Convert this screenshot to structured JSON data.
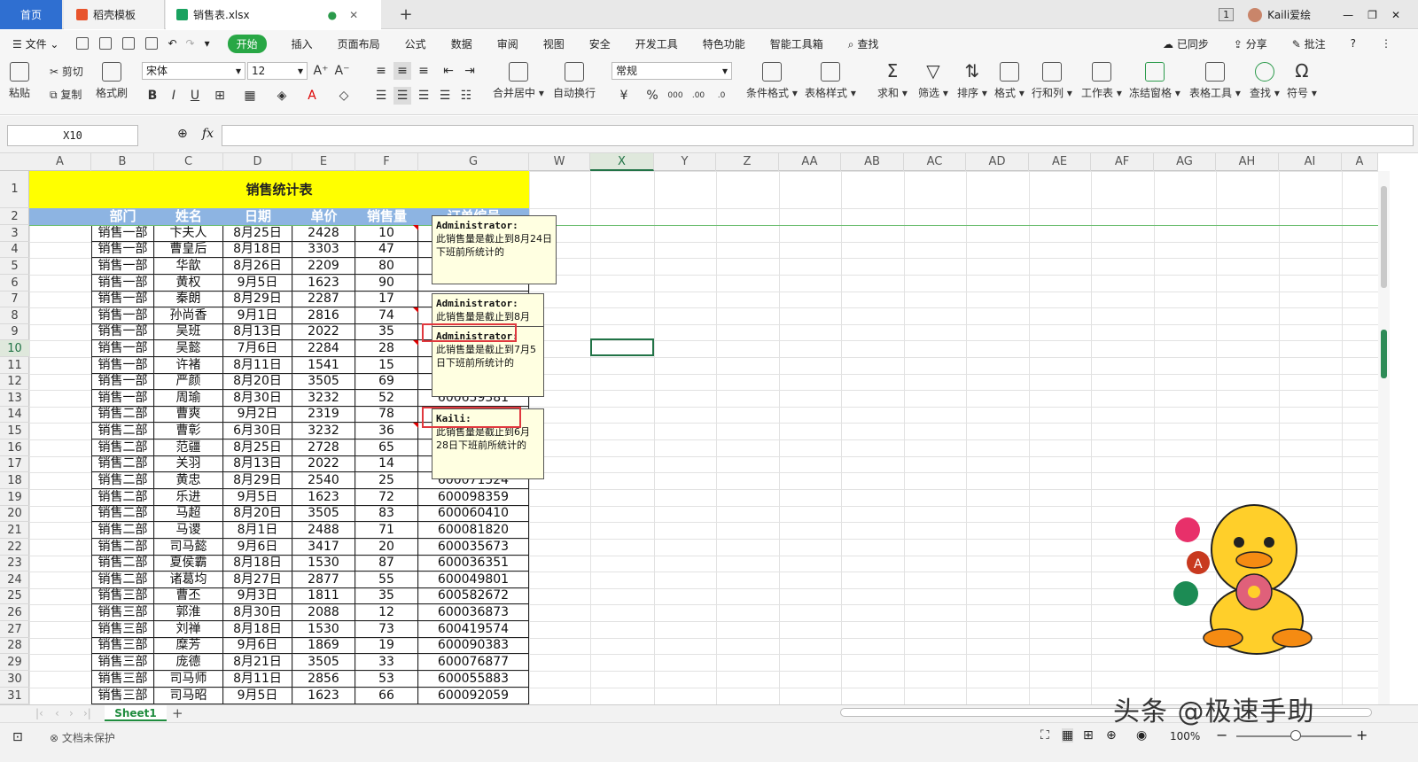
{
  "tabs": {
    "home": "首页",
    "templates": "稻壳模板",
    "file": "销售表.xlsx",
    "plus": "+"
  },
  "window": {
    "badge": "1",
    "user": "Kaili爱绘"
  },
  "menu": {
    "file": "文件",
    "items": [
      "开始",
      "插入",
      "页面布局",
      "公式",
      "数据",
      "审阅",
      "视图",
      "安全",
      "开发工具",
      "特色功能",
      "智能工具箱"
    ],
    "search": "查找",
    "sync": "已同步",
    "share": "分享",
    "comment": "批注",
    "help": "?"
  },
  "ribbon": {
    "paste": "粘贴",
    "cut": "剪切",
    "copy": "复制",
    "format_painter": "格式刷",
    "font": "宋体",
    "size": "12",
    "merge": "合并居中",
    "wrap": "自动换行",
    "numfmt": "常规",
    "cond_format": "条件格式",
    "table_style": "表格样式",
    "sum": "求和",
    "filter": "筛选",
    "sort": "排序",
    "format": "格式",
    "rowcol": "行和列",
    "sheet": "工作表",
    "freeze": "冻结窗格",
    "table_tools": "表格工具",
    "find": "查找",
    "symbol": "符号",
    "bold": "B",
    "italic": "I",
    "underline": "U",
    "percent": "%"
  },
  "formula": {
    "namebox": "X10",
    "fx": "fx"
  },
  "columns": [
    "A",
    "B",
    "C",
    "D",
    "E",
    "F",
    "G",
    "W",
    "X",
    "Y",
    "Z",
    "AA",
    "AB",
    "AC",
    "AD",
    "AE",
    "AF",
    "AG",
    "AH",
    "AI",
    "A"
  ],
  "rows": [
    "1",
    "2",
    "3",
    "4",
    "5",
    "6",
    "7",
    "8",
    "9",
    "10",
    "11",
    "12",
    "13",
    "14",
    "15",
    "16",
    "17",
    "18",
    "19",
    "20",
    "21",
    "22",
    "23",
    "24",
    "25",
    "26",
    "27",
    "28",
    "29",
    "30",
    "31"
  ],
  "sheet_title": "销售统计表",
  "headers": [
    "部门",
    "姓名",
    "日期",
    "单价",
    "销售量",
    "订单编号"
  ],
  "data": [
    [
      "销售一部",
      "卞夫人",
      "8月25日",
      "2428",
      "10",
      ""
    ],
    [
      "销售一部",
      "曹皇后",
      "8月18日",
      "3303",
      "47",
      ""
    ],
    [
      "销售一部",
      "华歆",
      "8月26日",
      "2209",
      "80",
      ""
    ],
    [
      "销售一部",
      "黄权",
      "9月5日",
      "1623",
      "90",
      ""
    ],
    [
      "销售一部",
      "秦朗",
      "8月29日",
      "2287",
      "17",
      ""
    ],
    [
      "销售一部",
      "孙尚香",
      "9月1日",
      "2816",
      "74",
      ""
    ],
    [
      "销售一部",
      "吴班",
      "8月13日",
      "2022",
      "35",
      ""
    ],
    [
      "销售一部",
      "吴懿",
      "7月6日",
      "2284",
      "28",
      ""
    ],
    [
      "销售一部",
      "许褚",
      "8月11日",
      "1541",
      "15",
      ""
    ],
    [
      "销售一部",
      "严颜",
      "8月20日",
      "3505",
      "69",
      ""
    ],
    [
      "销售一部",
      "周瑜",
      "8月30日",
      "3232",
      "52",
      "600659381"
    ],
    [
      "销售二部",
      "曹爽",
      "9月2日",
      "2319",
      "78",
      ""
    ],
    [
      "销售二部",
      "曹彰",
      "6月30日",
      "3232",
      "36",
      ""
    ],
    [
      "销售二部",
      "范疆",
      "8月25日",
      "2728",
      "65",
      ""
    ],
    [
      "销售二部",
      "关羽",
      "8月13日",
      "2022",
      "14",
      ""
    ],
    [
      "销售二部",
      "黄忠",
      "8月29日",
      "2540",
      "25",
      "600071524"
    ],
    [
      "销售二部",
      "乐进",
      "9月5日",
      "1623",
      "72",
      "600098359"
    ],
    [
      "销售二部",
      "马超",
      "8月20日",
      "3505",
      "83",
      "600060410"
    ],
    [
      "销售二部",
      "马谡",
      "8月1日",
      "2488",
      "71",
      "600081820"
    ],
    [
      "销售二部",
      "司马懿",
      "9月6日",
      "3417",
      "20",
      "600035673"
    ],
    [
      "销售二部",
      "夏侯霸",
      "8月18日",
      "1530",
      "87",
      "600036351"
    ],
    [
      "销售二部",
      "诸葛均",
      "8月27日",
      "2877",
      "55",
      "600049801"
    ],
    [
      "销售三部",
      "曹丕",
      "9月3日",
      "1811",
      "35",
      "600582672"
    ],
    [
      "销售三部",
      "郭淮",
      "8月30日",
      "2088",
      "12",
      "600036873"
    ],
    [
      "销售三部",
      "刘禅",
      "8月18日",
      "1530",
      "73",
      "600419574"
    ],
    [
      "销售三部",
      "糜芳",
      "9月6日",
      "1869",
      "19",
      "600090383"
    ],
    [
      "销售三部",
      "庞德",
      "8月21日",
      "3505",
      "33",
      "600076877"
    ],
    [
      "销售三部",
      "司马师",
      "8月11日",
      "2856",
      "53",
      "600055883"
    ],
    [
      "销售三部",
      "司马昭",
      "9月5日",
      "1623",
      "66",
      "600092059"
    ]
  ],
  "comments": [
    {
      "author": "Administrator:",
      "text": "此销售量是截止到8月24日下班前所统计的"
    },
    {
      "author": "Administrator:",
      "text": "此销售量是截止到8月"
    },
    {
      "author": "Administrator:",
      "text": "此销售量是截止到7月5日下班前所统计的"
    },
    {
      "author": "Kaili:",
      "text": "此销售量是截止到6月28日下班前所统计的"
    }
  ],
  "sheet_tab": "Sheet1",
  "status": {
    "protect": "文档未保护",
    "zoom": "100%"
  },
  "watermark": "头条 @极速手助",
  "colors": {
    "accent": "#217346",
    "title_bg": "#ffff00",
    "header_bg": "#8db4e2",
    "tab_blue": "#2f6fd1",
    "start_green": "#28a745"
  }
}
